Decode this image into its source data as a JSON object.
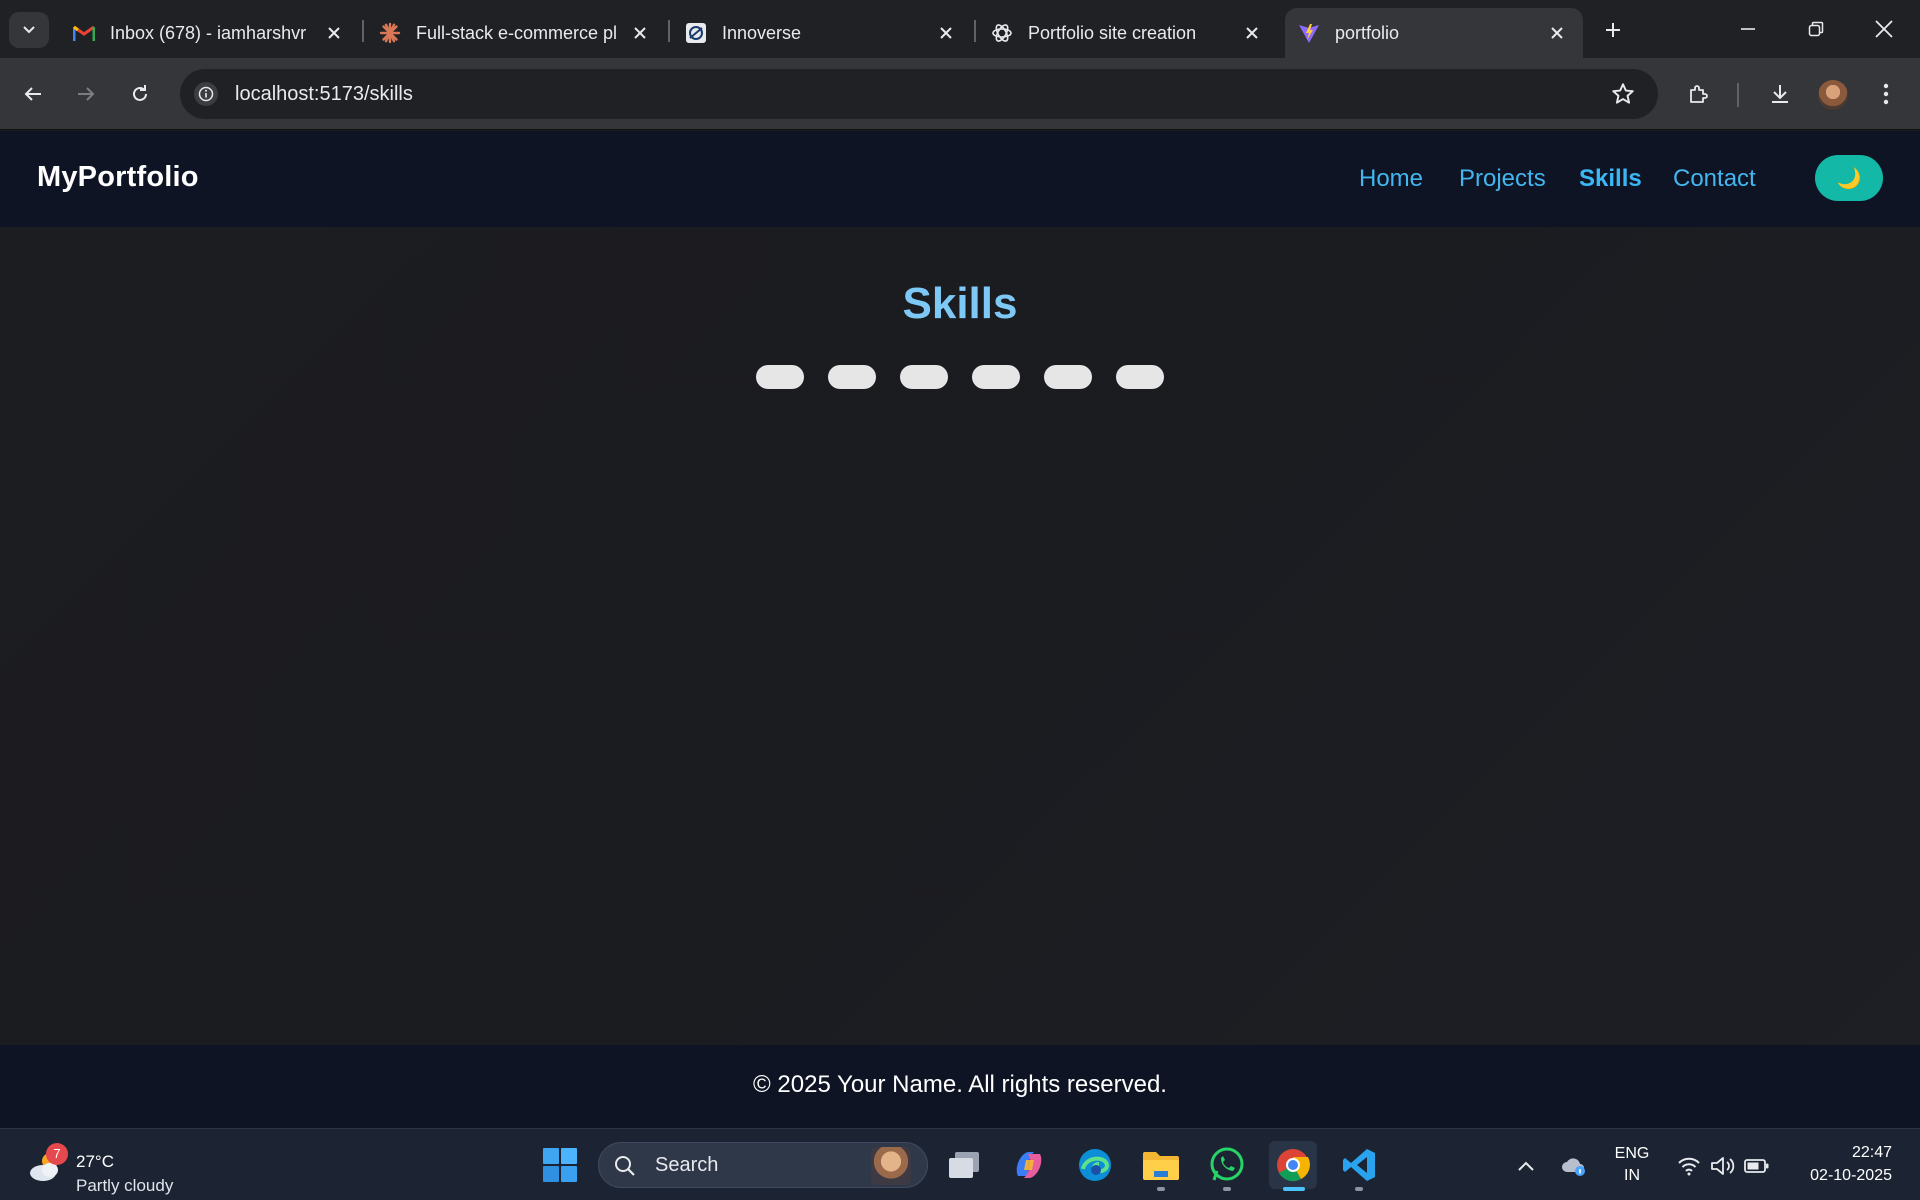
{
  "browser": {
    "tabs": [
      {
        "title": "Inbox (678) - iamharshvr",
        "icon": "gmail-icon"
      },
      {
        "title": "Full-stack e-commerce pl",
        "icon": "claude-icon"
      },
      {
        "title": "Innoverse",
        "icon": "innoverse-icon"
      },
      {
        "title": "Portfolio site creation",
        "icon": "chatgpt-icon"
      },
      {
        "title": "portfolio",
        "icon": "vite-icon"
      }
    ],
    "url": "localhost:5173/skills"
  },
  "site": {
    "brand": "MyPortfolio",
    "nav": [
      {
        "label": "Home"
      },
      {
        "label": "Projects"
      },
      {
        "label": "Skills"
      },
      {
        "label": "Contact"
      }
    ],
    "theme_toggle_glyph": "🌙",
    "heading": "Skills",
    "skill_pills": [
      "",
      "",
      "",
      "",
      "",
      ""
    ],
    "footer": "© 2025 Your Name. All rights reserved."
  },
  "taskbar": {
    "weather": {
      "temp": "27°C",
      "condition": "Partly cloudy",
      "badge": "7"
    },
    "search_label": "Search",
    "lang": {
      "line1": "ENG",
      "line2": "IN"
    },
    "time": "22:47",
    "date": "02-10-2025"
  },
  "colors": {
    "accent_link": "#43b6ef",
    "heading": "#7dc8f5",
    "toggle": "#14b8a6",
    "nav_bg": "#0e1424"
  }
}
